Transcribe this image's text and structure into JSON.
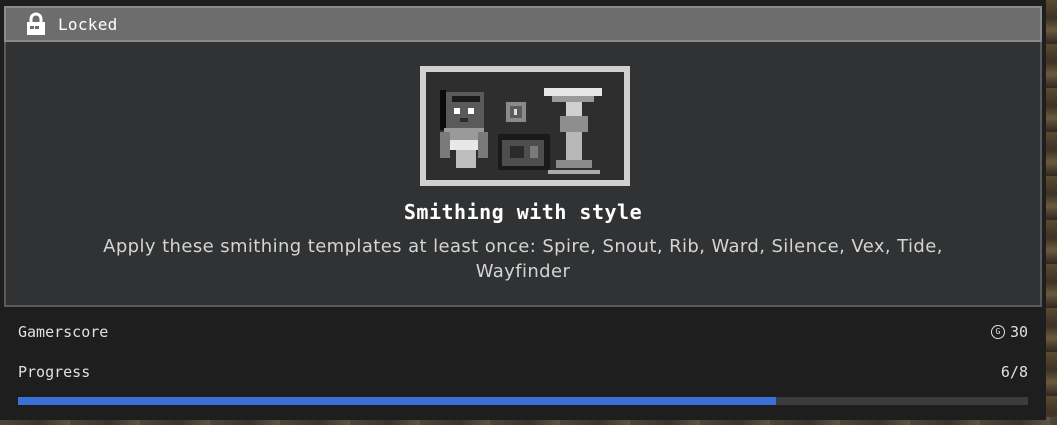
{
  "header": {
    "icon": "lock-icon",
    "status_label": "Locked"
  },
  "achievement": {
    "art_icon": "smithing-templates-art",
    "title": "Smithing with style",
    "description": "Apply these smithing templates at least once: Spire, Snout, Rib, Ward, Silence, Vex, Tide, Wayfinder"
  },
  "stats": {
    "gamerscore_label": "Gamerscore",
    "gamerscore_icon": "gamerscore-icon",
    "gamerscore_value": "30",
    "progress_label": "Progress",
    "progress_value": "6/8",
    "progress_fraction": 0.75
  },
  "colors": {
    "progress_fill": "#3b6fd9",
    "title_bar": "#6d6d6e",
    "card": "#313233"
  }
}
